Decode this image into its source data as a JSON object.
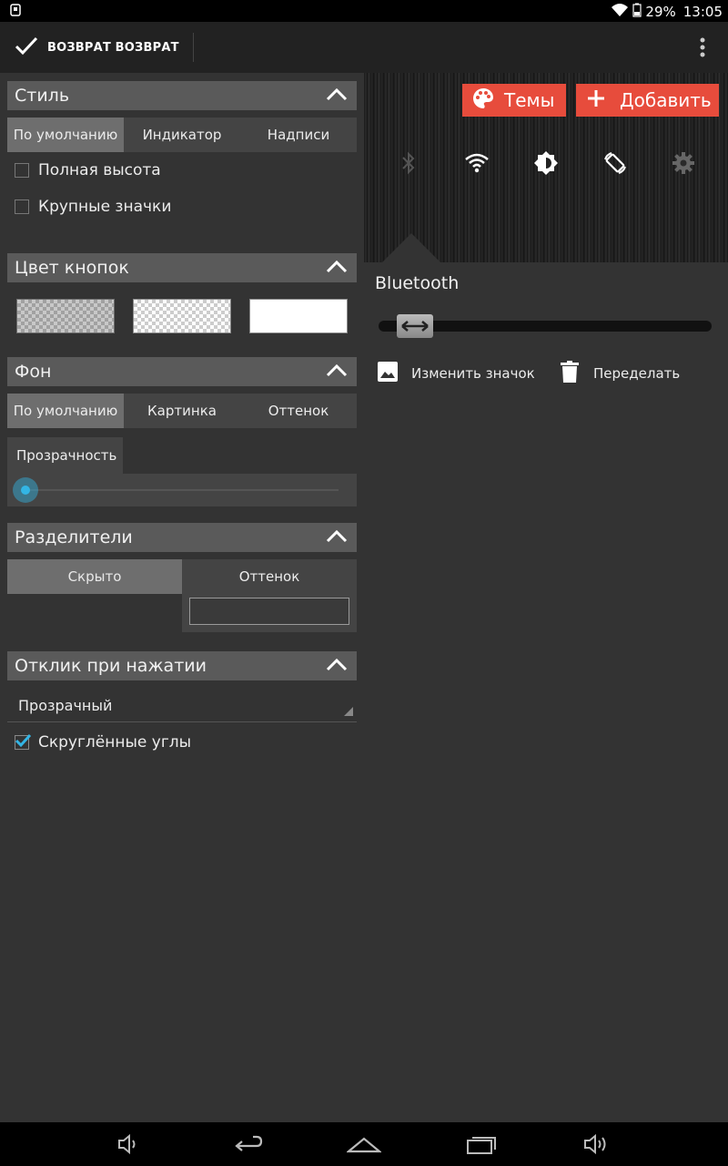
{
  "status": {
    "battery": "29%",
    "time": "13:05"
  },
  "actionbar": {
    "done_label": "ВОЗВРАТ ВОЗВРАТ"
  },
  "style_section": {
    "title": "Стиль",
    "tabs": [
      "По умолчанию",
      "Индикатор",
      "Надписи"
    ],
    "selected_tab": 0,
    "options": [
      {
        "label": "Полная высота",
        "checked": false
      },
      {
        "label": "Крупные значки",
        "checked": false
      }
    ]
  },
  "button_color_section": {
    "title": "Цвет кнопок"
  },
  "background_section": {
    "title": "Фон",
    "tabs": [
      "По умолчанию",
      "Картинка",
      "Оттенок"
    ],
    "selected_tab": 0,
    "transparency_label": "Прозрачность",
    "transparency_value": 0
  },
  "dividers_section": {
    "title": "Разделители",
    "tabs": [
      "Скрыто",
      "Оттенок"
    ],
    "selected_tab": 0
  },
  "touch_section": {
    "title": "Отклик при нажатии",
    "dropdown_value": "Прозрачный",
    "rounded_label": "Скруглённые углы",
    "rounded_checked": true
  },
  "preview": {
    "themes_button": "Темы",
    "add_button": "Добавить",
    "toggle_label": "Bluetooth",
    "change_icon": "Изменить значок",
    "redo": "Переделать"
  },
  "colors": {
    "accent_red": "#e74c3c",
    "slider_blue": "#33b5e5",
    "check_blue": "#33b5e5"
  }
}
